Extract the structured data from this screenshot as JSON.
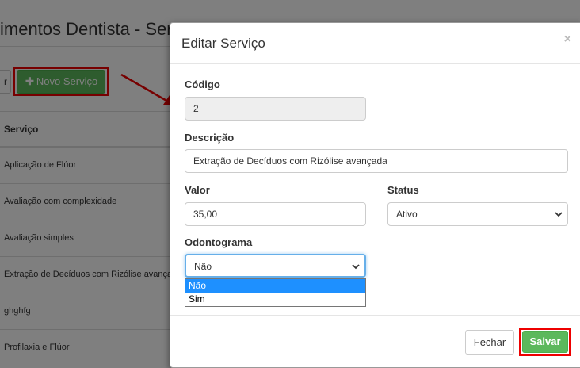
{
  "background": {
    "page_title": "imentos Dentista - Ser",
    "prev_button": "r",
    "new_button": "Novo Serviço",
    "table_header": "Serviço",
    "rows": [
      "Aplicação de Flúor",
      "Avaliação com complexidade",
      "Avaliação simples",
      "Extração de Decíduos com Rizólise avançada",
      "ghghfg",
      "Profilaxia e Flúor"
    ]
  },
  "modal": {
    "title": "Editar Serviço",
    "close": "×",
    "fields": {
      "codigo": {
        "label": "Código",
        "value": "2"
      },
      "descricao": {
        "label": "Descrição",
        "value": "Extração de Decíduos com Rizólise avançada"
      },
      "valor": {
        "label": "Valor",
        "value": "35,00"
      },
      "status": {
        "label": "Status",
        "value": "Ativo"
      },
      "odontograma": {
        "label": "Odontograma",
        "value": "Não",
        "options": [
          "Não",
          "Sim"
        ]
      }
    },
    "buttons": {
      "fechar": "Fechar",
      "salvar": "Salvar"
    }
  },
  "colors": {
    "success": "#5cb85c",
    "highlight": "#ee0000",
    "selected_option": "#1e90ff"
  }
}
